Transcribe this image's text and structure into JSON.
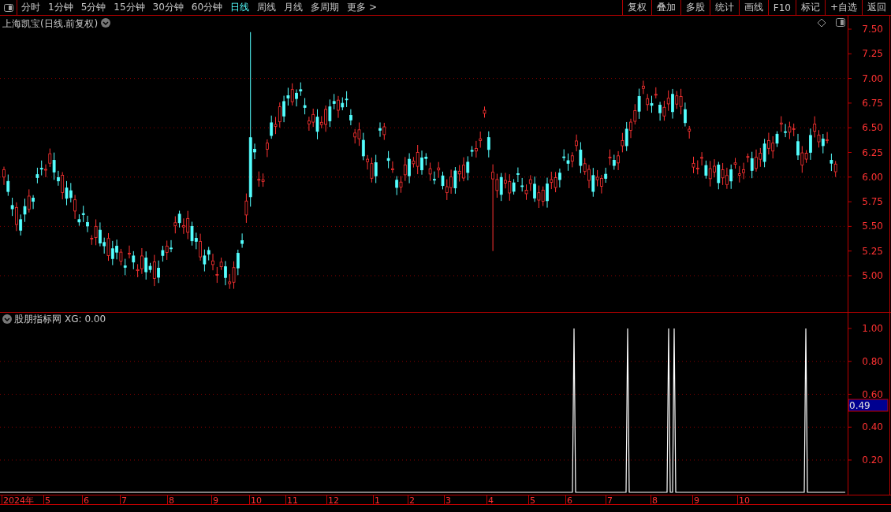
{
  "toolbar": {
    "periods": [
      {
        "label": "分时",
        "selected": false
      },
      {
        "label": "1分钟",
        "selected": false
      },
      {
        "label": "5分钟",
        "selected": false
      },
      {
        "label": "15分钟",
        "selected": false
      },
      {
        "label": "30分钟",
        "selected": false
      },
      {
        "label": "60分钟",
        "selected": false
      },
      {
        "label": "日线",
        "selected": true
      },
      {
        "label": "周线",
        "selected": false
      },
      {
        "label": "月线",
        "selected": false
      },
      {
        "label": "多周期",
        "selected": false
      },
      {
        "label": "更多 >",
        "selected": false
      }
    ],
    "actions": [
      "复权",
      "叠加",
      "多股",
      "统计",
      "画线",
      "F10",
      "标记",
      "+自选",
      "返回"
    ]
  },
  "price_pane": {
    "title": "上海凯宝(日线.前复权)",
    "axis_labels": [
      "7.50",
      "7.25",
      "7.00",
      "6.75",
      "6.50",
      "6.25",
      "6.00",
      "5.75",
      "5.50",
      "5.25",
      "5.00"
    ]
  },
  "indicator_pane": {
    "title": "股朋指标网",
    "readout": "XG: 0.00",
    "axis_labels": [
      "1.00",
      "0.80",
      "0.60",
      "0.40",
      "0.20"
    ],
    "current_value": "0.49"
  },
  "time_axis": {
    "labels": [
      "2024年",
      "5",
      "6",
      "7",
      "8",
      "9",
      "10",
      "11",
      "12",
      "1",
      "2",
      "3",
      "4",
      "5",
      "6",
      "7",
      "8",
      "9",
      "10"
    ]
  }
}
